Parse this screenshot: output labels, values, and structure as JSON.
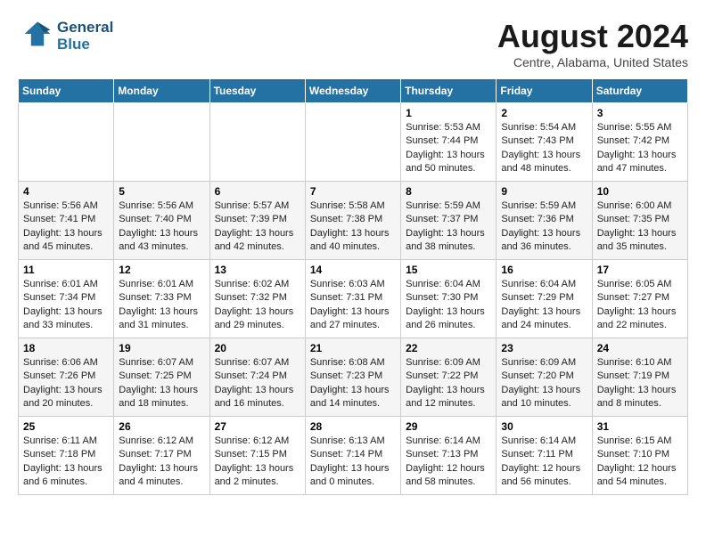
{
  "header": {
    "logo_line1": "General",
    "logo_line2": "Blue",
    "title": "August 2024",
    "subtitle": "Centre, Alabama, United States"
  },
  "days_of_week": [
    "Sunday",
    "Monday",
    "Tuesday",
    "Wednesday",
    "Thursday",
    "Friday",
    "Saturday"
  ],
  "weeks": [
    [
      {
        "day": "",
        "info": ""
      },
      {
        "day": "",
        "info": ""
      },
      {
        "day": "",
        "info": ""
      },
      {
        "day": "",
        "info": ""
      },
      {
        "day": "1",
        "info": "Sunrise: 5:53 AM\nSunset: 7:44 PM\nDaylight: 13 hours\nand 50 minutes."
      },
      {
        "day": "2",
        "info": "Sunrise: 5:54 AM\nSunset: 7:43 PM\nDaylight: 13 hours\nand 48 minutes."
      },
      {
        "day": "3",
        "info": "Sunrise: 5:55 AM\nSunset: 7:42 PM\nDaylight: 13 hours\nand 47 minutes."
      }
    ],
    [
      {
        "day": "4",
        "info": "Sunrise: 5:56 AM\nSunset: 7:41 PM\nDaylight: 13 hours\nand 45 minutes."
      },
      {
        "day": "5",
        "info": "Sunrise: 5:56 AM\nSunset: 7:40 PM\nDaylight: 13 hours\nand 43 minutes."
      },
      {
        "day": "6",
        "info": "Sunrise: 5:57 AM\nSunset: 7:39 PM\nDaylight: 13 hours\nand 42 minutes."
      },
      {
        "day": "7",
        "info": "Sunrise: 5:58 AM\nSunset: 7:38 PM\nDaylight: 13 hours\nand 40 minutes."
      },
      {
        "day": "8",
        "info": "Sunrise: 5:59 AM\nSunset: 7:37 PM\nDaylight: 13 hours\nand 38 minutes."
      },
      {
        "day": "9",
        "info": "Sunrise: 5:59 AM\nSunset: 7:36 PM\nDaylight: 13 hours\nand 36 minutes."
      },
      {
        "day": "10",
        "info": "Sunrise: 6:00 AM\nSunset: 7:35 PM\nDaylight: 13 hours\nand 35 minutes."
      }
    ],
    [
      {
        "day": "11",
        "info": "Sunrise: 6:01 AM\nSunset: 7:34 PM\nDaylight: 13 hours\nand 33 minutes."
      },
      {
        "day": "12",
        "info": "Sunrise: 6:01 AM\nSunset: 7:33 PM\nDaylight: 13 hours\nand 31 minutes."
      },
      {
        "day": "13",
        "info": "Sunrise: 6:02 AM\nSunset: 7:32 PM\nDaylight: 13 hours\nand 29 minutes."
      },
      {
        "day": "14",
        "info": "Sunrise: 6:03 AM\nSunset: 7:31 PM\nDaylight: 13 hours\nand 27 minutes."
      },
      {
        "day": "15",
        "info": "Sunrise: 6:04 AM\nSunset: 7:30 PM\nDaylight: 13 hours\nand 26 minutes."
      },
      {
        "day": "16",
        "info": "Sunrise: 6:04 AM\nSunset: 7:29 PM\nDaylight: 13 hours\nand 24 minutes."
      },
      {
        "day": "17",
        "info": "Sunrise: 6:05 AM\nSunset: 7:27 PM\nDaylight: 13 hours\nand 22 minutes."
      }
    ],
    [
      {
        "day": "18",
        "info": "Sunrise: 6:06 AM\nSunset: 7:26 PM\nDaylight: 13 hours\nand 20 minutes."
      },
      {
        "day": "19",
        "info": "Sunrise: 6:07 AM\nSunset: 7:25 PM\nDaylight: 13 hours\nand 18 minutes."
      },
      {
        "day": "20",
        "info": "Sunrise: 6:07 AM\nSunset: 7:24 PM\nDaylight: 13 hours\nand 16 minutes."
      },
      {
        "day": "21",
        "info": "Sunrise: 6:08 AM\nSunset: 7:23 PM\nDaylight: 13 hours\nand 14 minutes."
      },
      {
        "day": "22",
        "info": "Sunrise: 6:09 AM\nSunset: 7:22 PM\nDaylight: 13 hours\nand 12 minutes."
      },
      {
        "day": "23",
        "info": "Sunrise: 6:09 AM\nSunset: 7:20 PM\nDaylight: 13 hours\nand 10 minutes."
      },
      {
        "day": "24",
        "info": "Sunrise: 6:10 AM\nSunset: 7:19 PM\nDaylight: 13 hours\nand 8 minutes."
      }
    ],
    [
      {
        "day": "25",
        "info": "Sunrise: 6:11 AM\nSunset: 7:18 PM\nDaylight: 13 hours\nand 6 minutes."
      },
      {
        "day": "26",
        "info": "Sunrise: 6:12 AM\nSunset: 7:17 PM\nDaylight: 13 hours\nand 4 minutes."
      },
      {
        "day": "27",
        "info": "Sunrise: 6:12 AM\nSunset: 7:15 PM\nDaylight: 13 hours\nand 2 minutes."
      },
      {
        "day": "28",
        "info": "Sunrise: 6:13 AM\nSunset: 7:14 PM\nDaylight: 13 hours\nand 0 minutes."
      },
      {
        "day": "29",
        "info": "Sunrise: 6:14 AM\nSunset: 7:13 PM\nDaylight: 12 hours\nand 58 minutes."
      },
      {
        "day": "30",
        "info": "Sunrise: 6:14 AM\nSunset: 7:11 PM\nDaylight: 12 hours\nand 56 minutes."
      },
      {
        "day": "31",
        "info": "Sunrise: 6:15 AM\nSunset: 7:10 PM\nDaylight: 12 hours\nand 54 minutes."
      }
    ]
  ]
}
